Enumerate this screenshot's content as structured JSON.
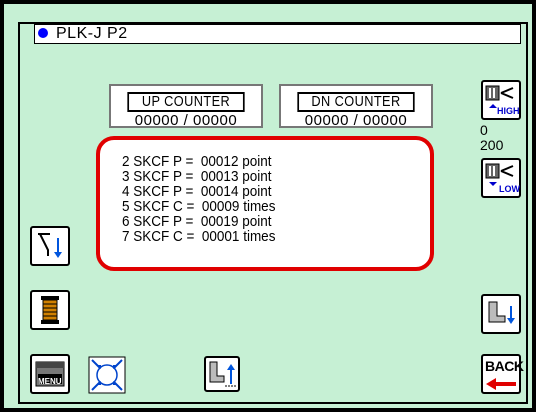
{
  "title": "PLK-J P2",
  "up_counter": {
    "label": "UP COUNTER",
    "value": "00000 / 00000"
  },
  "dn_counter": {
    "label": "DN COUNTER",
    "value": "00000 / 00000"
  },
  "side": {
    "high_label": "HIGH",
    "low_label": "LOW",
    "value_top": "0",
    "value_bottom": "200",
    "back_label": "BACK"
  },
  "menu_label": "MENU",
  "rows": [
    "2 SKCF P =  00012 point",
    "3 SKCF P =  00013 point",
    "4 SKCF P =  00014 point",
    "5 SKCF C =  00009 times",
    "6 SKCF P =  00019 point",
    "7 SKCF C =  00001 times"
  ],
  "colors": {
    "background": "#c6f0d4",
    "highlight_border": "#e00000",
    "accent_blue": "#0000ff",
    "back_arrow": "#e00000"
  }
}
